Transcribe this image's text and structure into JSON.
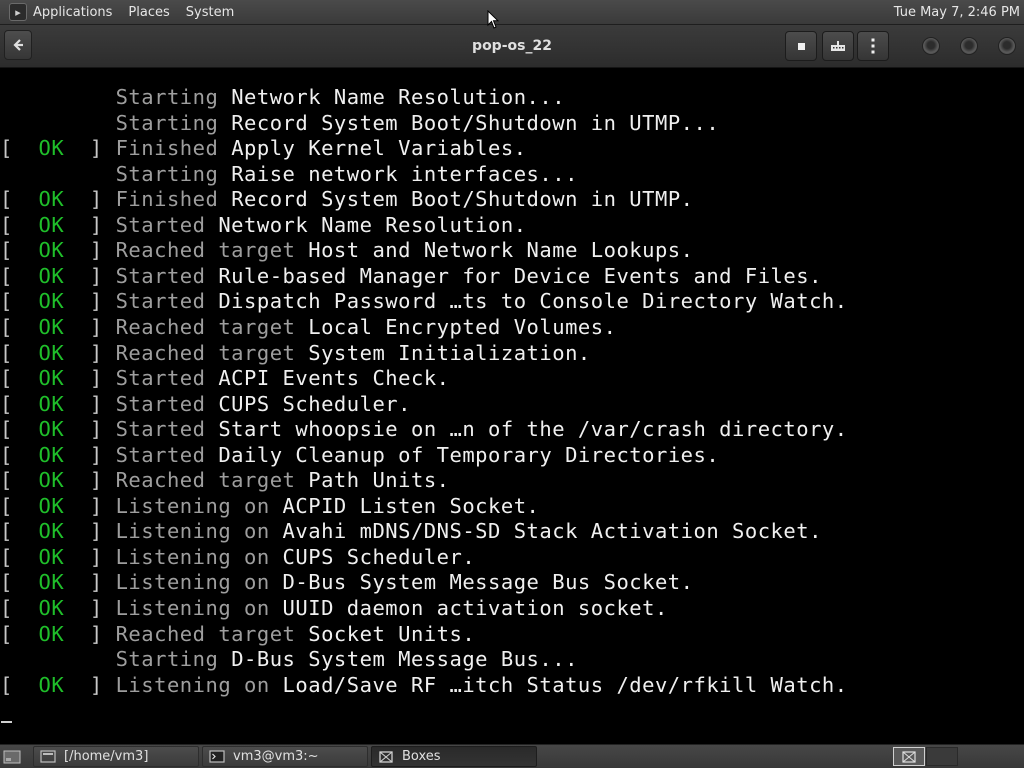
{
  "top_panel": {
    "menus": [
      "Applications",
      "Places",
      "System"
    ],
    "clock": "Tue May 7,  2:46 PM"
  },
  "window": {
    "title": "pop-os_22"
  },
  "console": {
    "lines": [
      {
        "status": "",
        "verb": "Starting",
        "text": "Network Name Resolution..."
      },
      {
        "status": "",
        "verb": "Starting",
        "text": "Record System Boot/Shutdown in UTMP..."
      },
      {
        "status": "OK",
        "verb": "Finished",
        "text": "Apply Kernel Variables."
      },
      {
        "status": "",
        "verb": "Starting",
        "text": "Raise network interfaces..."
      },
      {
        "status": "OK",
        "verb": "Finished",
        "text": "Record System Boot/Shutdown in UTMP."
      },
      {
        "status": "OK",
        "verb": "Started",
        "text": "Network Name Resolution."
      },
      {
        "status": "OK",
        "verb": "Reached target",
        "text": "Host and Network Name Lookups."
      },
      {
        "status": "OK",
        "verb": "Started",
        "text": "Rule-based Manager for Device Events and Files."
      },
      {
        "status": "OK",
        "verb": "Started",
        "text": "Dispatch Password …ts to Console Directory Watch."
      },
      {
        "status": "OK",
        "verb": "Reached target",
        "text": "Local Encrypted Volumes."
      },
      {
        "status": "OK",
        "verb": "Reached target",
        "text": "System Initialization."
      },
      {
        "status": "OK",
        "verb": "Started",
        "text": "ACPI Events Check."
      },
      {
        "status": "OK",
        "verb": "Started",
        "text": "CUPS Scheduler."
      },
      {
        "status": "OK",
        "verb": "Started",
        "text": "Start whoopsie on …n of the /var/crash directory."
      },
      {
        "status": "OK",
        "verb": "Started",
        "text": "Daily Cleanup of Temporary Directories."
      },
      {
        "status": "OK",
        "verb": "Reached target",
        "text": "Path Units."
      },
      {
        "status": "OK",
        "verb": "Listening on",
        "text": "ACPID Listen Socket."
      },
      {
        "status": "OK",
        "verb": "Listening on",
        "text": "Avahi mDNS/DNS-SD Stack Activation Socket."
      },
      {
        "status": "OK",
        "verb": "Listening on",
        "text": "CUPS Scheduler."
      },
      {
        "status": "OK",
        "verb": "Listening on",
        "text": "D-Bus System Message Bus Socket."
      },
      {
        "status": "OK",
        "verb": "Listening on",
        "text": "UUID daemon activation socket."
      },
      {
        "status": "OK",
        "verb": "Reached target",
        "text": "Socket Units."
      },
      {
        "status": "",
        "verb": "Starting",
        "text": "D-Bus System Message Bus..."
      },
      {
        "status": "OK",
        "verb": "Listening on",
        "text": "Load/Save RF …itch Status /dev/rfkill Watch."
      }
    ],
    "colors": {
      "ok": "#1fbf2a",
      "verb": "#9e9e9e",
      "text": "#f0f0f0",
      "background": "#000000"
    }
  },
  "taskbar": {
    "tasks": [
      {
        "label": "[/home/vm3]",
        "icon": "folder-icon"
      },
      {
        "label": "vm3@vm3:~",
        "icon": "terminal-icon"
      },
      {
        "label": "Boxes",
        "icon": "boxes-icon"
      }
    ]
  }
}
